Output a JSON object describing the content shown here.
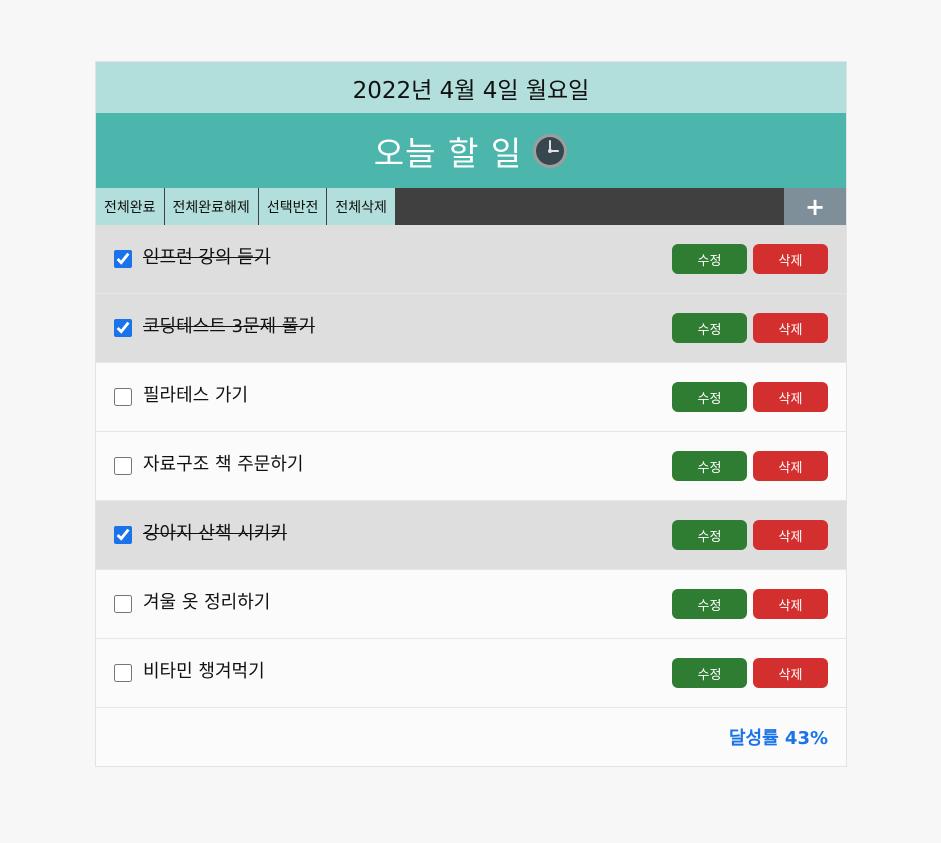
{
  "header": {
    "date": "2022년 4월 4일 월요일",
    "title": "오늘 할 일",
    "clock_icon": "clock-icon"
  },
  "toolbar": {
    "complete_all": "전체완료",
    "uncomplete_all": "전체완료해제",
    "invert_selection": "선택반전",
    "delete_all": "전체삭제",
    "add": "+"
  },
  "todos": [
    {
      "text": "인프런 강의 듣기",
      "done": true,
      "edit_label": "수정",
      "delete_label": "삭제"
    },
    {
      "text": "코딩테스트 3문제 풀기",
      "done": true,
      "edit_label": "수정",
      "delete_label": "삭제"
    },
    {
      "text": "필라테스 가기",
      "done": false,
      "edit_label": "수정",
      "delete_label": "삭제"
    },
    {
      "text": "자료구조 책 주문하기",
      "done": false,
      "edit_label": "수정",
      "delete_label": "삭제"
    },
    {
      "text": "강아지 산책 시키키",
      "done": true,
      "edit_label": "수정",
      "delete_label": "삭제"
    },
    {
      "text": "겨울 옷 정리하기",
      "done": false,
      "edit_label": "수정",
      "delete_label": "삭제"
    },
    {
      "text": "비타민 챙겨먹기",
      "done": false,
      "edit_label": "수정",
      "delete_label": "삭제"
    }
  ],
  "footer": {
    "achievement": "달성률 43%"
  },
  "colors": {
    "date_bg": "#b2dfdb",
    "title_bg": "#4db6ac",
    "toolbar_bg": "#404040",
    "add_bg": "#7f8f99",
    "edit_btn": "#2e7d32",
    "delete_btn": "#d32f2f",
    "done_row_bg": "#dedede",
    "achievement": "#1a73e8"
  }
}
